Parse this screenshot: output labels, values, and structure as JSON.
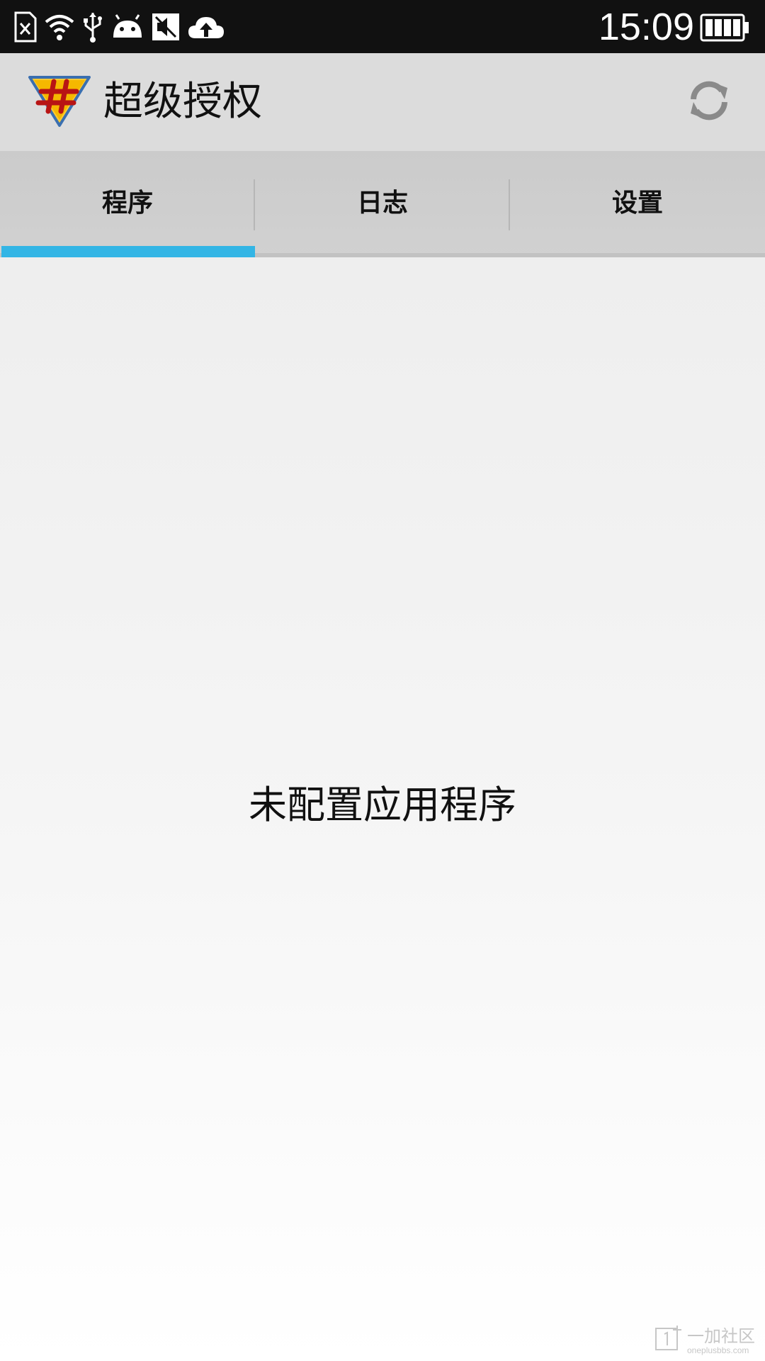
{
  "status_bar": {
    "time": "15:09",
    "icons": [
      "sim-error-icon",
      "wifi-icon",
      "usb-icon",
      "android-debug-icon",
      "no-sound-icon",
      "cloud-upload-icon"
    ],
    "battery_icon": "battery-icon"
  },
  "app_bar": {
    "title": "超级授权",
    "logo_icon": "superuser-logo-icon",
    "refresh_icon": "refresh-icon"
  },
  "tabs": [
    {
      "label": "程序",
      "selected": true
    },
    {
      "label": "日志",
      "selected": false
    },
    {
      "label": "设置",
      "selected": false
    }
  ],
  "content": {
    "empty_message": "未配置应用程序"
  },
  "watermark": {
    "cn": "一加社区",
    "en": "oneplusbbs.com"
  },
  "colors": {
    "status_bar": "#111111",
    "action_bar": "#dcdcdc",
    "tab_bar": "#cecece",
    "tab_indicator": "#33b5e5",
    "content_top": "#eeeeee",
    "content_bottom": "#ffffff"
  }
}
